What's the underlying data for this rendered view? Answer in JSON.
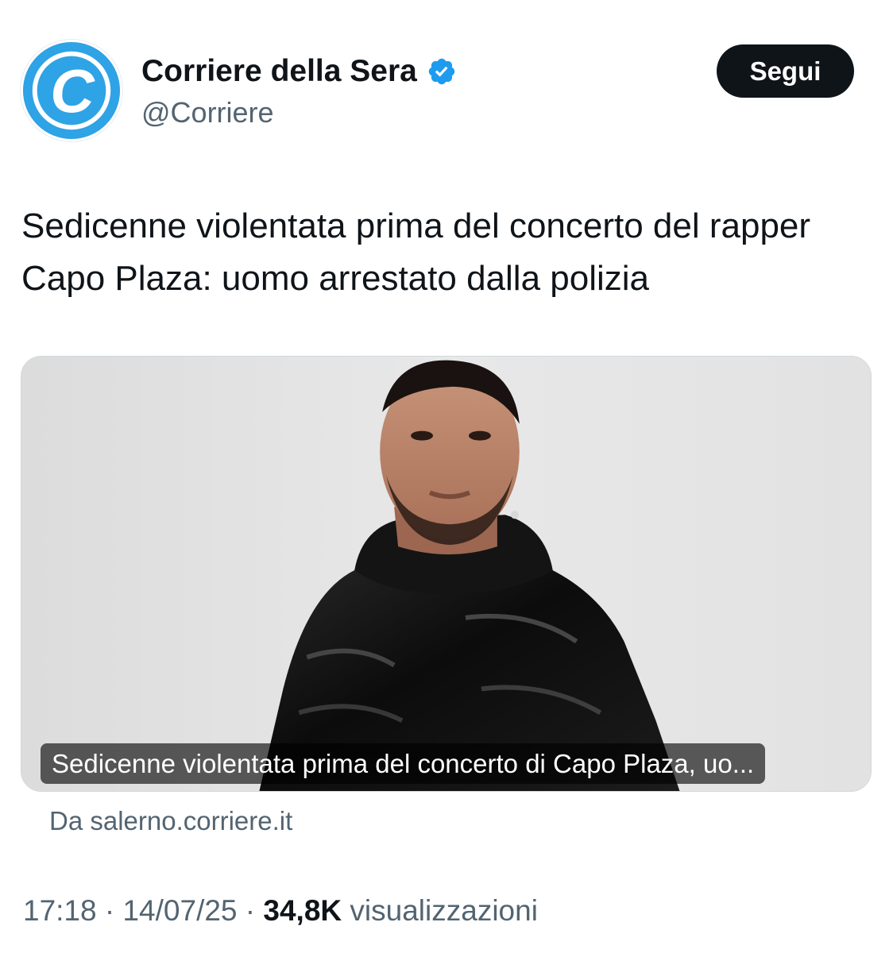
{
  "account": {
    "display_name": "Corriere della Sera",
    "handle": "@Corriere",
    "avatar_icon": "corriere-logo-icon",
    "avatar_letter": "C",
    "verified_icon": "verified-badge-icon",
    "verified_color": "#1d9bf0",
    "brand_color": "#2ea3e6"
  },
  "follow_button": {
    "label": "Segui"
  },
  "tweet": {
    "text": "Sedicenne violentata prima del concerto del rapper Capo Plaza: uomo arrestato dalla polizia"
  },
  "link_card": {
    "image_icon": "article-photo",
    "caption": "Sedicenne violentata prima del concerto di Capo Plaza, uo...",
    "source": "Da salerno.corriere.it"
  },
  "meta": {
    "time": "17:18",
    "separator": " · ",
    "date": "14/07/25",
    "views_count": "34,8K",
    "views_label": "visualizzazioni"
  }
}
